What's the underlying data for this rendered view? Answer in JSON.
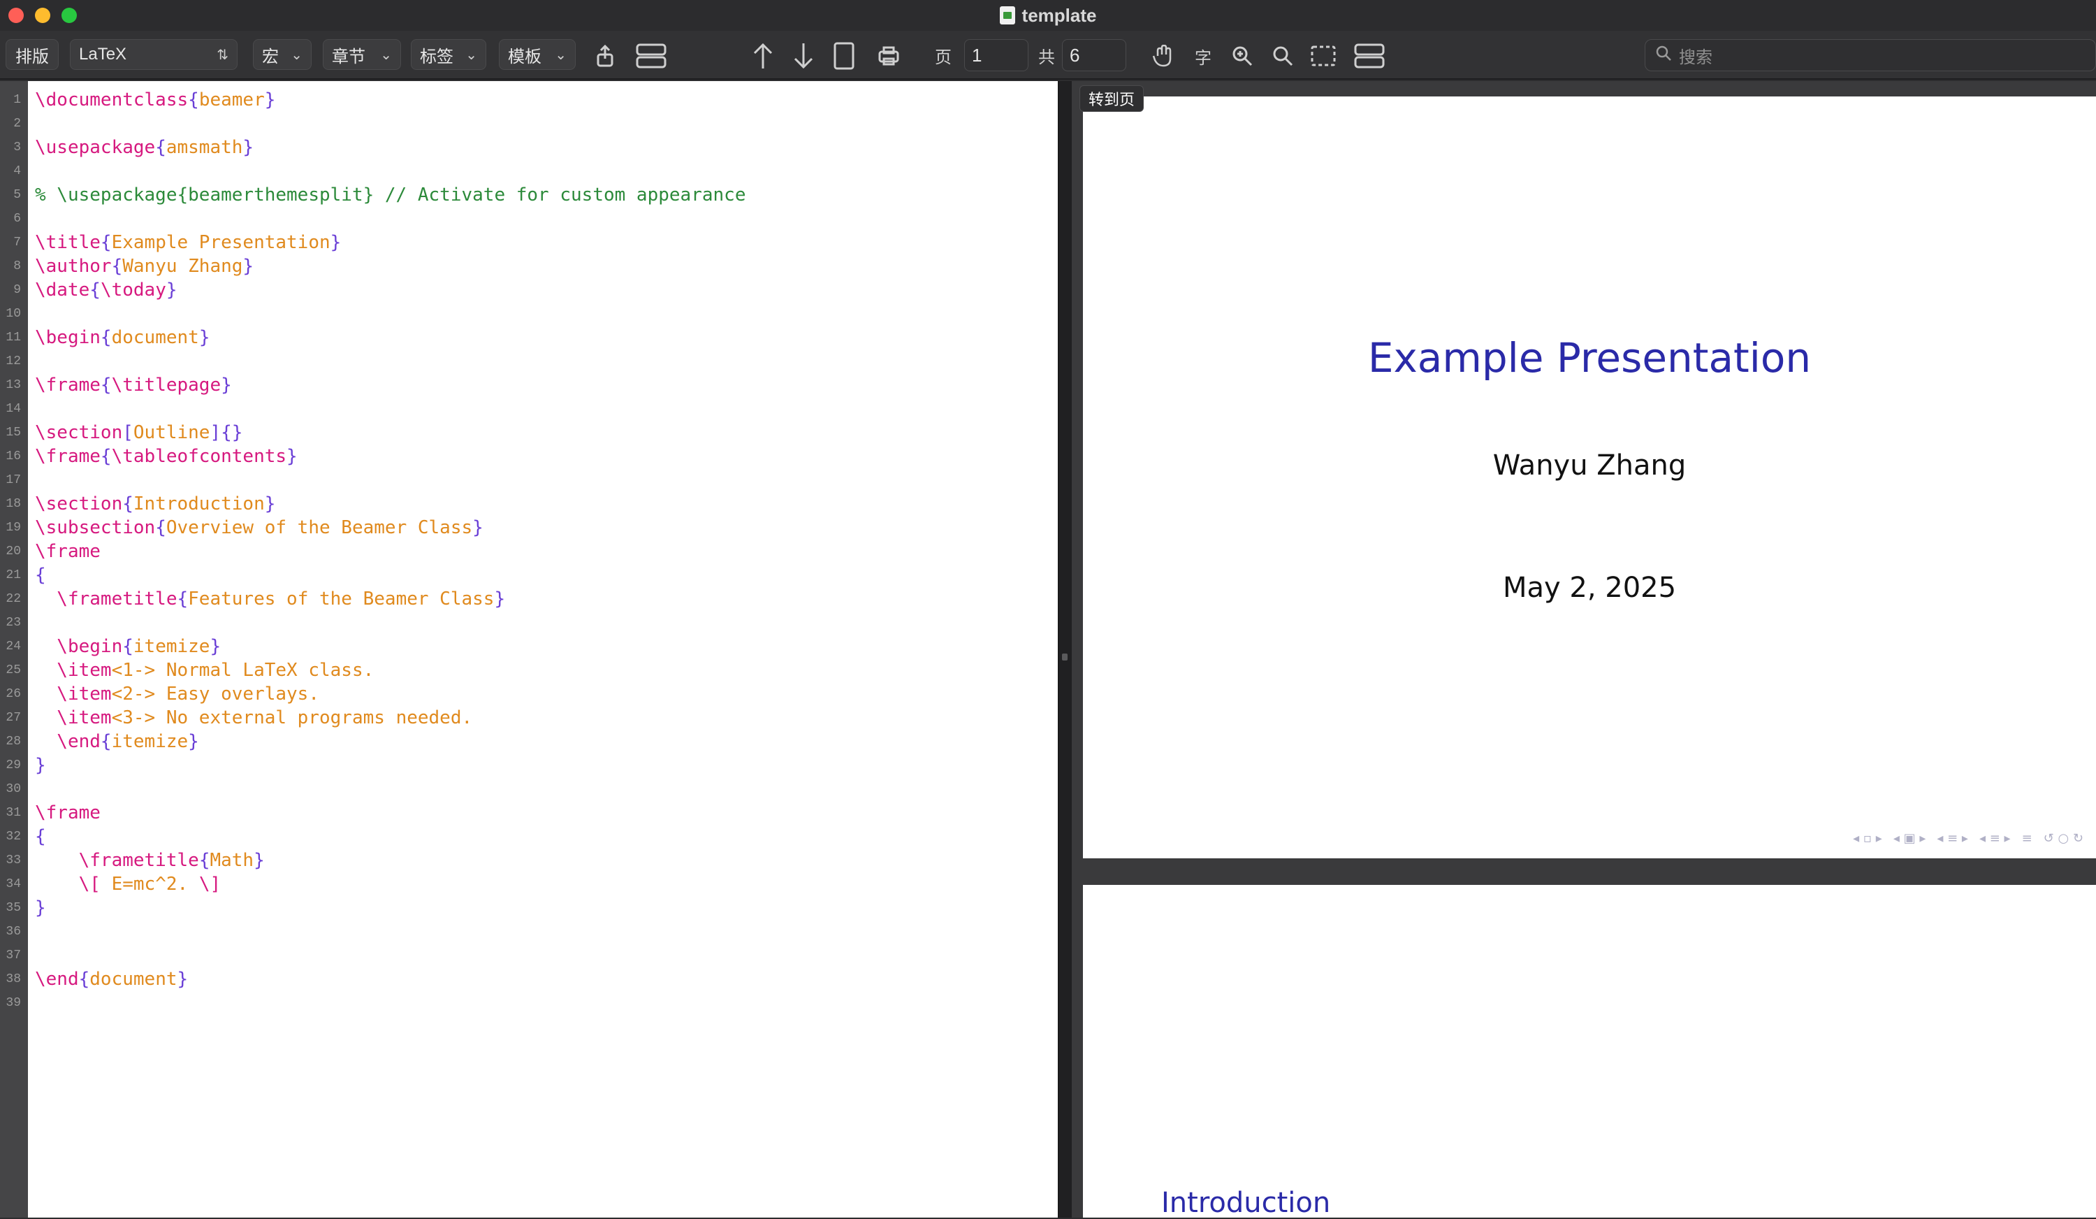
{
  "window": {
    "title": "template"
  },
  "toolbar": {
    "typeset_label": "排版",
    "engine_value": "LaTeX",
    "macro_label": "宏",
    "section_label": "章节",
    "tags_label": "标签",
    "template_label": "模板",
    "page_label": "页",
    "page_value": "1",
    "total_label": "共",
    "total_value": "6",
    "search_placeholder": "搜索"
  },
  "editor": {
    "lines": [
      {
        "n": "1",
        "segments": [
          {
            "t": "\\documentclass",
            "c": "cmd"
          },
          {
            "t": "{",
            "c": "br"
          },
          {
            "t": "beamer",
            "c": "arg"
          },
          {
            "t": "}",
            "c": "br"
          }
        ]
      },
      {
        "n": "2",
        "segments": []
      },
      {
        "n": "3",
        "segments": [
          {
            "t": "\\usepackage",
            "c": "cmd"
          },
          {
            "t": "{",
            "c": "br"
          },
          {
            "t": "amsmath",
            "c": "arg"
          },
          {
            "t": "}",
            "c": "br"
          }
        ]
      },
      {
        "n": "4",
        "segments": []
      },
      {
        "n": "5",
        "segments": [
          {
            "t": "% \\usepackage{beamerthemesplit} // Activate for custom appearance",
            "c": "cmt"
          }
        ]
      },
      {
        "n": "6",
        "segments": []
      },
      {
        "n": "7",
        "segments": [
          {
            "t": "\\title",
            "c": "cmd"
          },
          {
            "t": "{",
            "c": "br"
          },
          {
            "t": "Example Presentation",
            "c": "arg"
          },
          {
            "t": "}",
            "c": "br"
          }
        ]
      },
      {
        "n": "8",
        "segments": [
          {
            "t": "\\author",
            "c": "cmd"
          },
          {
            "t": "{",
            "c": "br"
          },
          {
            "t": "Wanyu Zhang",
            "c": "arg"
          },
          {
            "t": "}",
            "c": "br"
          }
        ]
      },
      {
        "n": "9",
        "segments": [
          {
            "t": "\\date",
            "c": "cmd"
          },
          {
            "t": "{",
            "c": "br"
          },
          {
            "t": "\\today",
            "c": "cmd"
          },
          {
            "t": "}",
            "c": "br"
          }
        ]
      },
      {
        "n": "10",
        "segments": []
      },
      {
        "n": "11",
        "segments": [
          {
            "t": "\\begin",
            "c": "cmd"
          },
          {
            "t": "{",
            "c": "br"
          },
          {
            "t": "document",
            "c": "arg"
          },
          {
            "t": "}",
            "c": "br"
          }
        ]
      },
      {
        "n": "12",
        "segments": []
      },
      {
        "n": "13",
        "segments": [
          {
            "t": "\\frame",
            "c": "cmd"
          },
          {
            "t": "{",
            "c": "br"
          },
          {
            "t": "\\titlepage",
            "c": "cmd"
          },
          {
            "t": "}",
            "c": "br"
          }
        ]
      },
      {
        "n": "14",
        "segments": []
      },
      {
        "n": "15",
        "segments": [
          {
            "t": "\\section",
            "c": "cmd"
          },
          {
            "t": "[",
            "c": "br"
          },
          {
            "t": "Outline",
            "c": "arg"
          },
          {
            "t": "]",
            "c": "br"
          },
          {
            "t": "{}",
            "c": "br"
          }
        ]
      },
      {
        "n": "16",
        "segments": [
          {
            "t": "\\frame",
            "c": "cmd"
          },
          {
            "t": "{",
            "c": "br"
          },
          {
            "t": "\\tableofcontents",
            "c": "cmd"
          },
          {
            "t": "}",
            "c": "br"
          }
        ]
      },
      {
        "n": "17",
        "segments": []
      },
      {
        "n": "18",
        "segments": [
          {
            "t": "\\section",
            "c": "cmd"
          },
          {
            "t": "{",
            "c": "br"
          },
          {
            "t": "Introduction",
            "c": "arg"
          },
          {
            "t": "}",
            "c": "br"
          }
        ]
      },
      {
        "n": "19",
        "segments": [
          {
            "t": "\\subsection",
            "c": "cmd"
          },
          {
            "t": "{",
            "c": "br"
          },
          {
            "t": "Overview of the Beamer Class",
            "c": "arg"
          },
          {
            "t": "}",
            "c": "br"
          }
        ]
      },
      {
        "n": "20",
        "segments": [
          {
            "t": "\\frame",
            "c": "cmd"
          }
        ]
      },
      {
        "n": "21",
        "segments": [
          {
            "t": "{",
            "c": "br"
          }
        ]
      },
      {
        "n": "22",
        "segments": [
          {
            "t": "  \\frametitle",
            "c": "cmd"
          },
          {
            "t": "{",
            "c": "br"
          },
          {
            "t": "Features of the Beamer Class",
            "c": "arg"
          },
          {
            "t": "}",
            "c": "br"
          }
        ]
      },
      {
        "n": "23",
        "segments": []
      },
      {
        "n": "24",
        "segments": [
          {
            "t": "  \\begin",
            "c": "cmd"
          },
          {
            "t": "{",
            "c": "br"
          },
          {
            "t": "itemize",
            "c": "arg"
          },
          {
            "t": "}",
            "c": "br"
          }
        ]
      },
      {
        "n": "25",
        "segments": [
          {
            "t": "  \\item",
            "c": "cmd"
          },
          {
            "t": "<1-> Normal LaTeX class.",
            "c": "arg"
          }
        ]
      },
      {
        "n": "26",
        "segments": [
          {
            "t": "  \\item",
            "c": "cmd"
          },
          {
            "t": "<2-> Easy overlays.",
            "c": "arg"
          }
        ]
      },
      {
        "n": "27",
        "segments": [
          {
            "t": "  \\item",
            "c": "cmd"
          },
          {
            "t": "<3-> No external programs needed.",
            "c": "arg"
          }
        ]
      },
      {
        "n": "28",
        "segments": [
          {
            "t": "  \\end",
            "c": "cmd"
          },
          {
            "t": "{",
            "c": "br"
          },
          {
            "t": "itemize",
            "c": "arg"
          },
          {
            "t": "}",
            "c": "br"
          }
        ]
      },
      {
        "n": "29",
        "segments": [
          {
            "t": "}",
            "c": "br"
          }
        ]
      },
      {
        "n": "30",
        "segments": []
      },
      {
        "n": "31",
        "segments": [
          {
            "t": "\\frame",
            "c": "cmd"
          }
        ]
      },
      {
        "n": "32",
        "segments": [
          {
            "t": "{",
            "c": "br"
          }
        ]
      },
      {
        "n": "33",
        "segments": [
          {
            "t": "    \\frametitle",
            "c": "cmd"
          },
          {
            "t": "{",
            "c": "br"
          },
          {
            "t": "Math",
            "c": "arg"
          },
          {
            "t": "}",
            "c": "br"
          }
        ]
      },
      {
        "n": "34",
        "segments": [
          {
            "t": "    \\[ ",
            "c": "cmd"
          },
          {
            "t": "E=mc^2. ",
            "c": "arg"
          },
          {
            "t": "\\]",
            "c": "cmd"
          }
        ]
      },
      {
        "n": "35",
        "segments": [
          {
            "t": "}",
            "c": "br"
          }
        ]
      },
      {
        "n": "36",
        "segments": []
      },
      {
        "n": "37",
        "segments": []
      },
      {
        "n": "38",
        "segments": [
          {
            "t": "\\end",
            "c": "cmd"
          },
          {
            "t": "{",
            "c": "br"
          },
          {
            "t": "document",
            "c": "arg"
          },
          {
            "t": "}",
            "c": "br"
          }
        ]
      },
      {
        "n": "39",
        "segments": []
      }
    ]
  },
  "preview": {
    "tooltip": "转到页",
    "slide1": {
      "title": "Example Presentation",
      "author": "Wanyu Zhang",
      "date": "May 2, 2025"
    },
    "slide2": {
      "heading": "Introduction"
    }
  }
}
